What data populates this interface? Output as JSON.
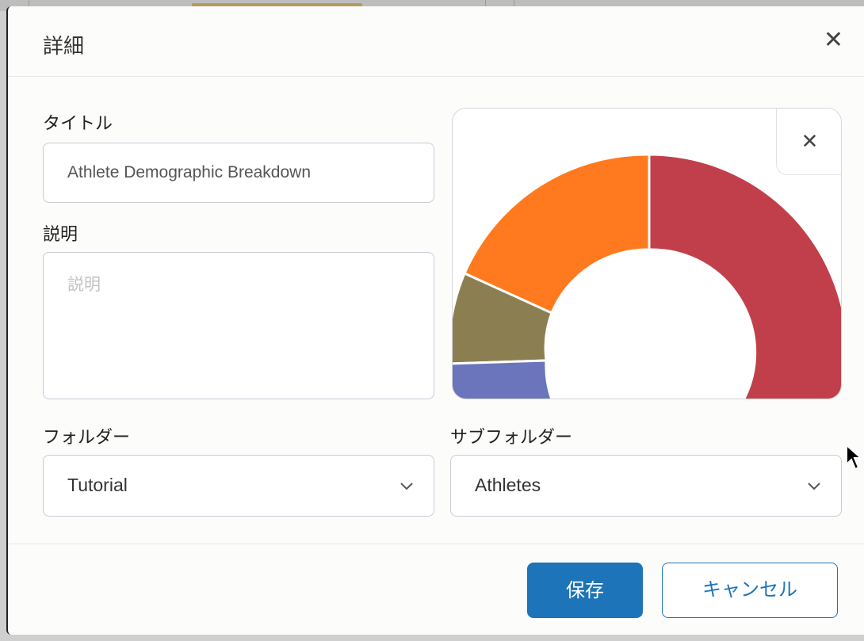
{
  "dialog": {
    "title": "詳細",
    "close_icon": "close-icon"
  },
  "form": {
    "title_label": "タイトル",
    "title_value": "Athlete Demographic Breakdown",
    "description_label": "説明",
    "description_placeholder": "説明",
    "folder_label": "フォルダー",
    "folder_value": "Tutorial",
    "subfolder_label": "サブフォルダー",
    "subfolder_value": "Athletes"
  },
  "preview": {
    "remove_icon": "close-icon"
  },
  "buttons": {
    "save_label": "保存",
    "cancel_label": "キャンセル"
  },
  "chart_data": {
    "type": "pie",
    "variant": "donut (partially visible, cropped)",
    "slices": [
      {
        "color": "#c13f4b",
        "visible_start_deg": 0,
        "visible_end_deg": 150
      },
      {
        "color": "#ff7a1f",
        "visible_start_deg": 300,
        "visible_end_deg": 360
      },
      {
        "color": "#8b7f52",
        "visible_start_deg": 270,
        "visible_end_deg": 300
      },
      {
        "color": "#6a75bb",
        "visible_start_deg": 255,
        "visible_end_deg": 270
      }
    ]
  }
}
